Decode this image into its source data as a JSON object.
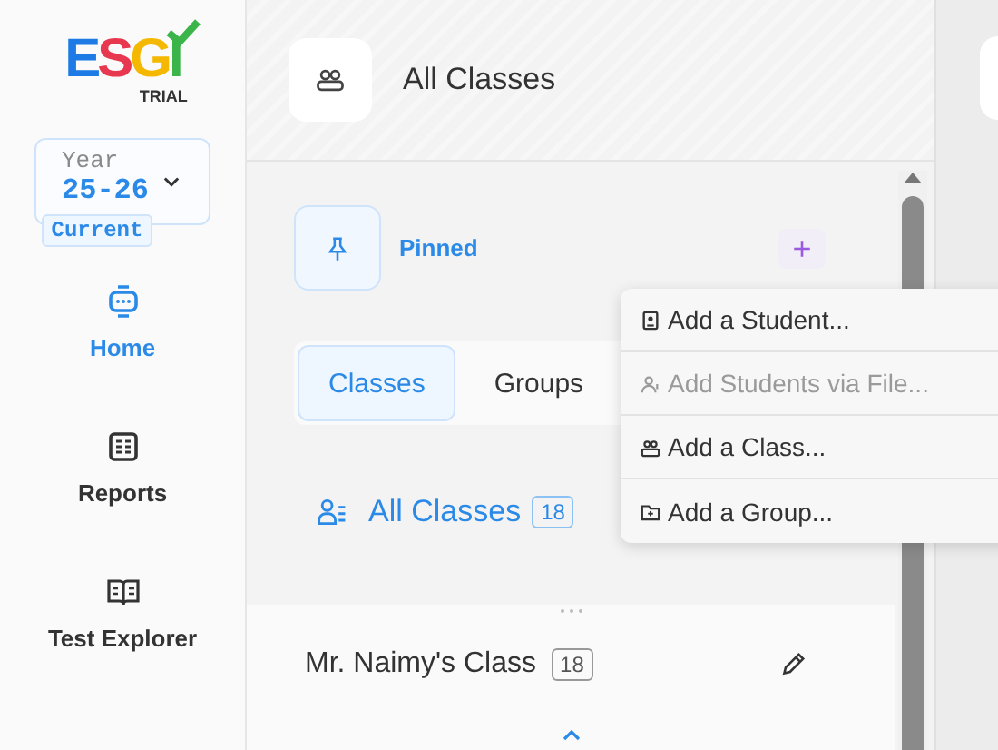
{
  "logo": {
    "letters": [
      {
        "text": "E",
        "color": "#1e7be6"
      },
      {
        "text": "S",
        "color": "#e8384f"
      },
      {
        "text": "G",
        "color": "#f5b800"
      },
      {
        "text": "I",
        "color": "#3bb54a"
      }
    ],
    "subtitle": "TRIAL"
  },
  "year": {
    "label": "Year",
    "value": "25-26",
    "badge": "Current"
  },
  "nav": [
    {
      "label": "Home",
      "kind": "home",
      "selected": true
    },
    {
      "label": "Reports",
      "kind": "reports",
      "selected": false
    },
    {
      "label": "Test Explorer",
      "kind": "book",
      "selected": false
    }
  ],
  "header": {
    "title": "All Classes"
  },
  "pinned": {
    "label": "Pinned",
    "add": "+"
  },
  "tabs": [
    {
      "label": "Classes",
      "selected": true
    },
    {
      "label": "Groups",
      "selected": false
    }
  ],
  "all_classes": {
    "label": "All Classes",
    "count": "18"
  },
  "class_row": {
    "name": "Mr. Naimy's Class",
    "count": "18"
  },
  "menu": [
    {
      "label": "Add a Student...",
      "kind": "student",
      "disabled": false
    },
    {
      "label": "Add Students via File...",
      "kind": "file",
      "disabled": true
    },
    {
      "label": "Add a Class...",
      "kind": "class",
      "disabled": false
    },
    {
      "label": "Add a Group...",
      "kind": "group",
      "disabled": false
    }
  ]
}
